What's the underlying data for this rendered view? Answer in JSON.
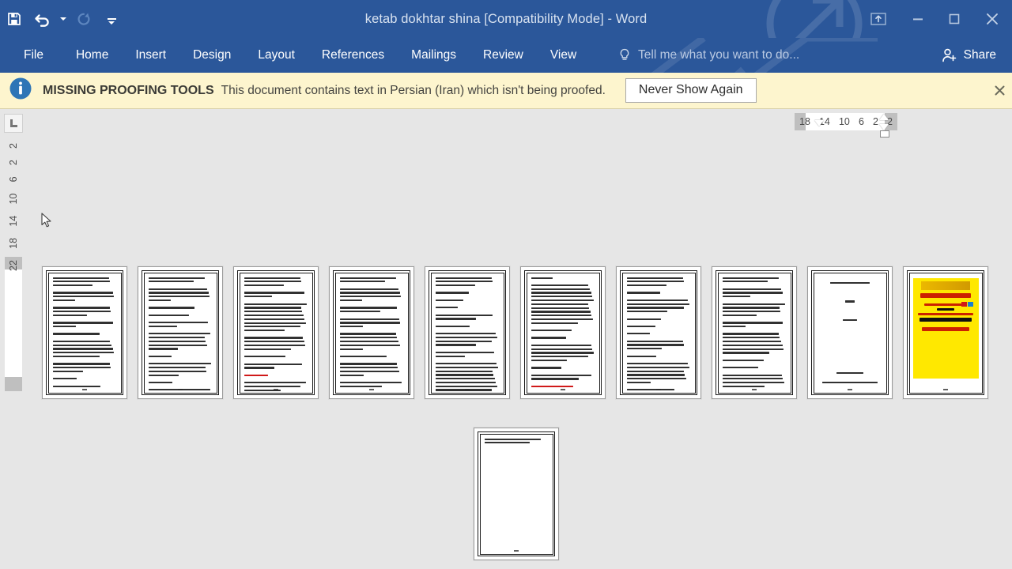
{
  "window": {
    "title": "ketab dokhtar shina [Compatibility Mode] - Word",
    "quick_access": [
      {
        "name": "save-button",
        "icon": "save-icon",
        "enabled": true
      },
      {
        "name": "undo-button",
        "icon": "undo-icon",
        "enabled": true
      },
      {
        "name": "undo-dropdown",
        "icon": "chevron-down-icon",
        "enabled": true
      },
      {
        "name": "redo-button",
        "icon": "redo-icon",
        "enabled": false
      },
      {
        "name": "customize-quick-access-toolbar",
        "icon": "chevron-down-bar-icon",
        "enabled": true
      }
    ],
    "controls": [
      {
        "name": "ribbon-display-options",
        "icon": "ribbon-display-icon",
        "glyph": "⬆"
      },
      {
        "name": "minimize-button",
        "icon": "minimize-icon",
        "glyph": "—"
      },
      {
        "name": "restore-button",
        "icon": "restore-icon",
        "glyph": "▢"
      },
      {
        "name": "close-button",
        "icon": "close-icon",
        "glyph": "✕"
      }
    ],
    "accent_color": "#2b579a",
    "title_color": "#d8e2f0"
  },
  "ribbon": {
    "tabs": [
      {
        "label": "File",
        "active": false
      },
      {
        "label": "Home",
        "active": false
      },
      {
        "label": "Insert",
        "active": false
      },
      {
        "label": "Design",
        "active": false
      },
      {
        "label": "Layout",
        "active": false
      },
      {
        "label": "References",
        "active": false
      },
      {
        "label": "Mailings",
        "active": false
      },
      {
        "label": "Review",
        "active": false
      },
      {
        "label": "View",
        "active": false
      }
    ],
    "tell_me": {
      "label": "Tell me what you want to do...",
      "icon": "lightbulb-icon"
    },
    "share": {
      "label": "Share",
      "icon": "person-add-icon"
    }
  },
  "message_bar": {
    "icon": "info-icon",
    "strong": "MISSING PROOFING TOOLS",
    "text": "This document contains text in Persian (Iran) which isn't being proofed.",
    "button": "Never Show Again",
    "close_icon": "close-icon",
    "background": "#fdf5ce"
  },
  "rulers": {
    "tab_stop_selector": {
      "icon": "left-tab-stop-icon",
      "label": "L"
    },
    "horizontal": {
      "ticks": [
        "18",
        "14",
        "10",
        "6",
        "2",
        "2"
      ],
      "markers": [
        "first-line-indent",
        "hanging-indent",
        "left-indent",
        "right-indent"
      ]
    },
    "vertical": {
      "ticks": [
        "2",
        "2",
        "6",
        "10",
        "14",
        "18",
        "22"
      ]
    }
  },
  "document": {
    "zoom_view": "multiple-pages",
    "pages": [
      {
        "n": 1,
        "kind": "text",
        "lines": [
          3,
          3,
          3,
          2,
          1,
          5,
          3,
          1,
          1,
          8,
          1,
          1,
          4
        ],
        "red_line": -1
      },
      {
        "n": 2,
        "kind": "text",
        "lines": [
          2,
          4,
          1,
          1,
          2,
          5,
          1,
          4,
          1,
          5
        ],
        "red_line": -1
      },
      {
        "n": 3,
        "kind": "text",
        "lines": [
          3,
          2,
          8,
          4,
          1,
          2,
          1,
          3,
          2
        ],
        "red_line": 6
      },
      {
        "n": 4,
        "kind": "text",
        "lines": [
          2,
          4,
          2,
          3,
          5,
          1,
          4,
          2,
          3
        ],
        "red_line": -1
      },
      {
        "n": 5,
        "kind": "text",
        "lines": [
          3,
          1,
          1,
          1,
          2,
          1,
          4,
          2,
          9,
          3,
          1,
          2
        ],
        "red_line": -1
      },
      {
        "n": 6,
        "kind": "text",
        "lines": [
          1,
          11,
          1,
          1,
          5,
          1,
          2,
          1,
          4,
          1,
          3,
          1,
          2
        ],
        "red_line": 7
      },
      {
        "n": 7,
        "kind": "text",
        "lines": [
          3,
          1,
          4,
          1,
          1,
          1,
          3,
          1,
          6,
          1,
          1,
          3
        ],
        "red_line": -1
      },
      {
        "n": 8,
        "kind": "text",
        "lines": [
          2,
          3,
          4,
          2,
          6,
          1,
          1,
          4,
          2,
          3
        ],
        "red_line": -1
      },
      {
        "n": 9,
        "kind": "title",
        "lines": [
          1,
          1,
          1
        ],
        "red_line": -1
      },
      {
        "n": 10,
        "kind": "ad",
        "ad": {
          "background": "#ffe800",
          "headline": "تحقیق آنلاین",
          "url": "Tahghighonline.ir",
          "line_ref": "مرجع دانلــــود",
          "line_file": "فایل",
          "line_formats": "ورد-پی دی اف - پاورپوینت",
          "line_price": "با کمترین قیمت بازار",
          "phone": "09981366624",
          "whatsapp": "واتساپ"
        }
      },
      {
        "n": 11,
        "kind": "last",
        "lines": [
          2
        ],
        "red_line": -1
      }
    ]
  }
}
